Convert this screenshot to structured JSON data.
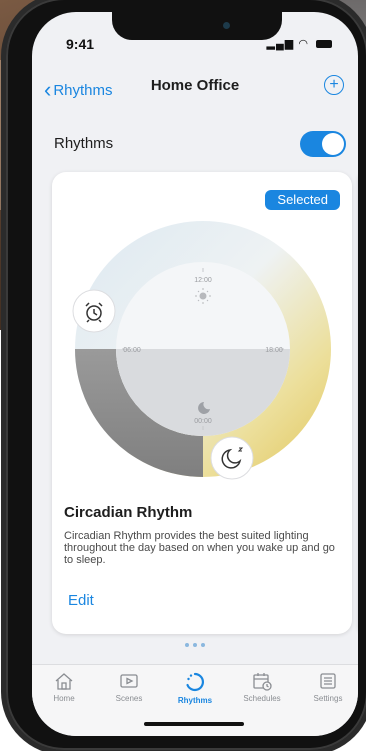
{
  "status": {
    "time": "9:41"
  },
  "nav": {
    "back_label": "Rhythms",
    "title": "Home Office"
  },
  "rhythms_row": {
    "label": "Rhythms",
    "toggle_on": true
  },
  "card": {
    "badge": "Selected",
    "title": "Circadian Rhythm",
    "description": "Circadian Rhythm provides the best suited lighting throughout the day based on when you wake up and go to sleep.",
    "edit_label": "Edit",
    "dial": {
      "top_label": "12:00",
      "left_label": "06:00",
      "right_label": "18:00",
      "bottom_label": "00:00",
      "wake_icon": "alarm-clock-icon",
      "sleep_icon": "moon-sleep-icon"
    }
  },
  "tabs": [
    {
      "label": "Home",
      "icon": "home-icon"
    },
    {
      "label": "Scenes",
      "icon": "scenes-icon"
    },
    {
      "label": "Rhythms",
      "icon": "rhythms-icon",
      "active": true
    },
    {
      "label": "Schedules",
      "icon": "schedules-icon"
    },
    {
      "label": "Settings",
      "icon": "settings-icon"
    }
  ],
  "colors": {
    "accent": "#1a86e0",
    "warm": "#e7cd6a",
    "cool": "#cfe6f6",
    "dark": "#8c8c8c"
  }
}
